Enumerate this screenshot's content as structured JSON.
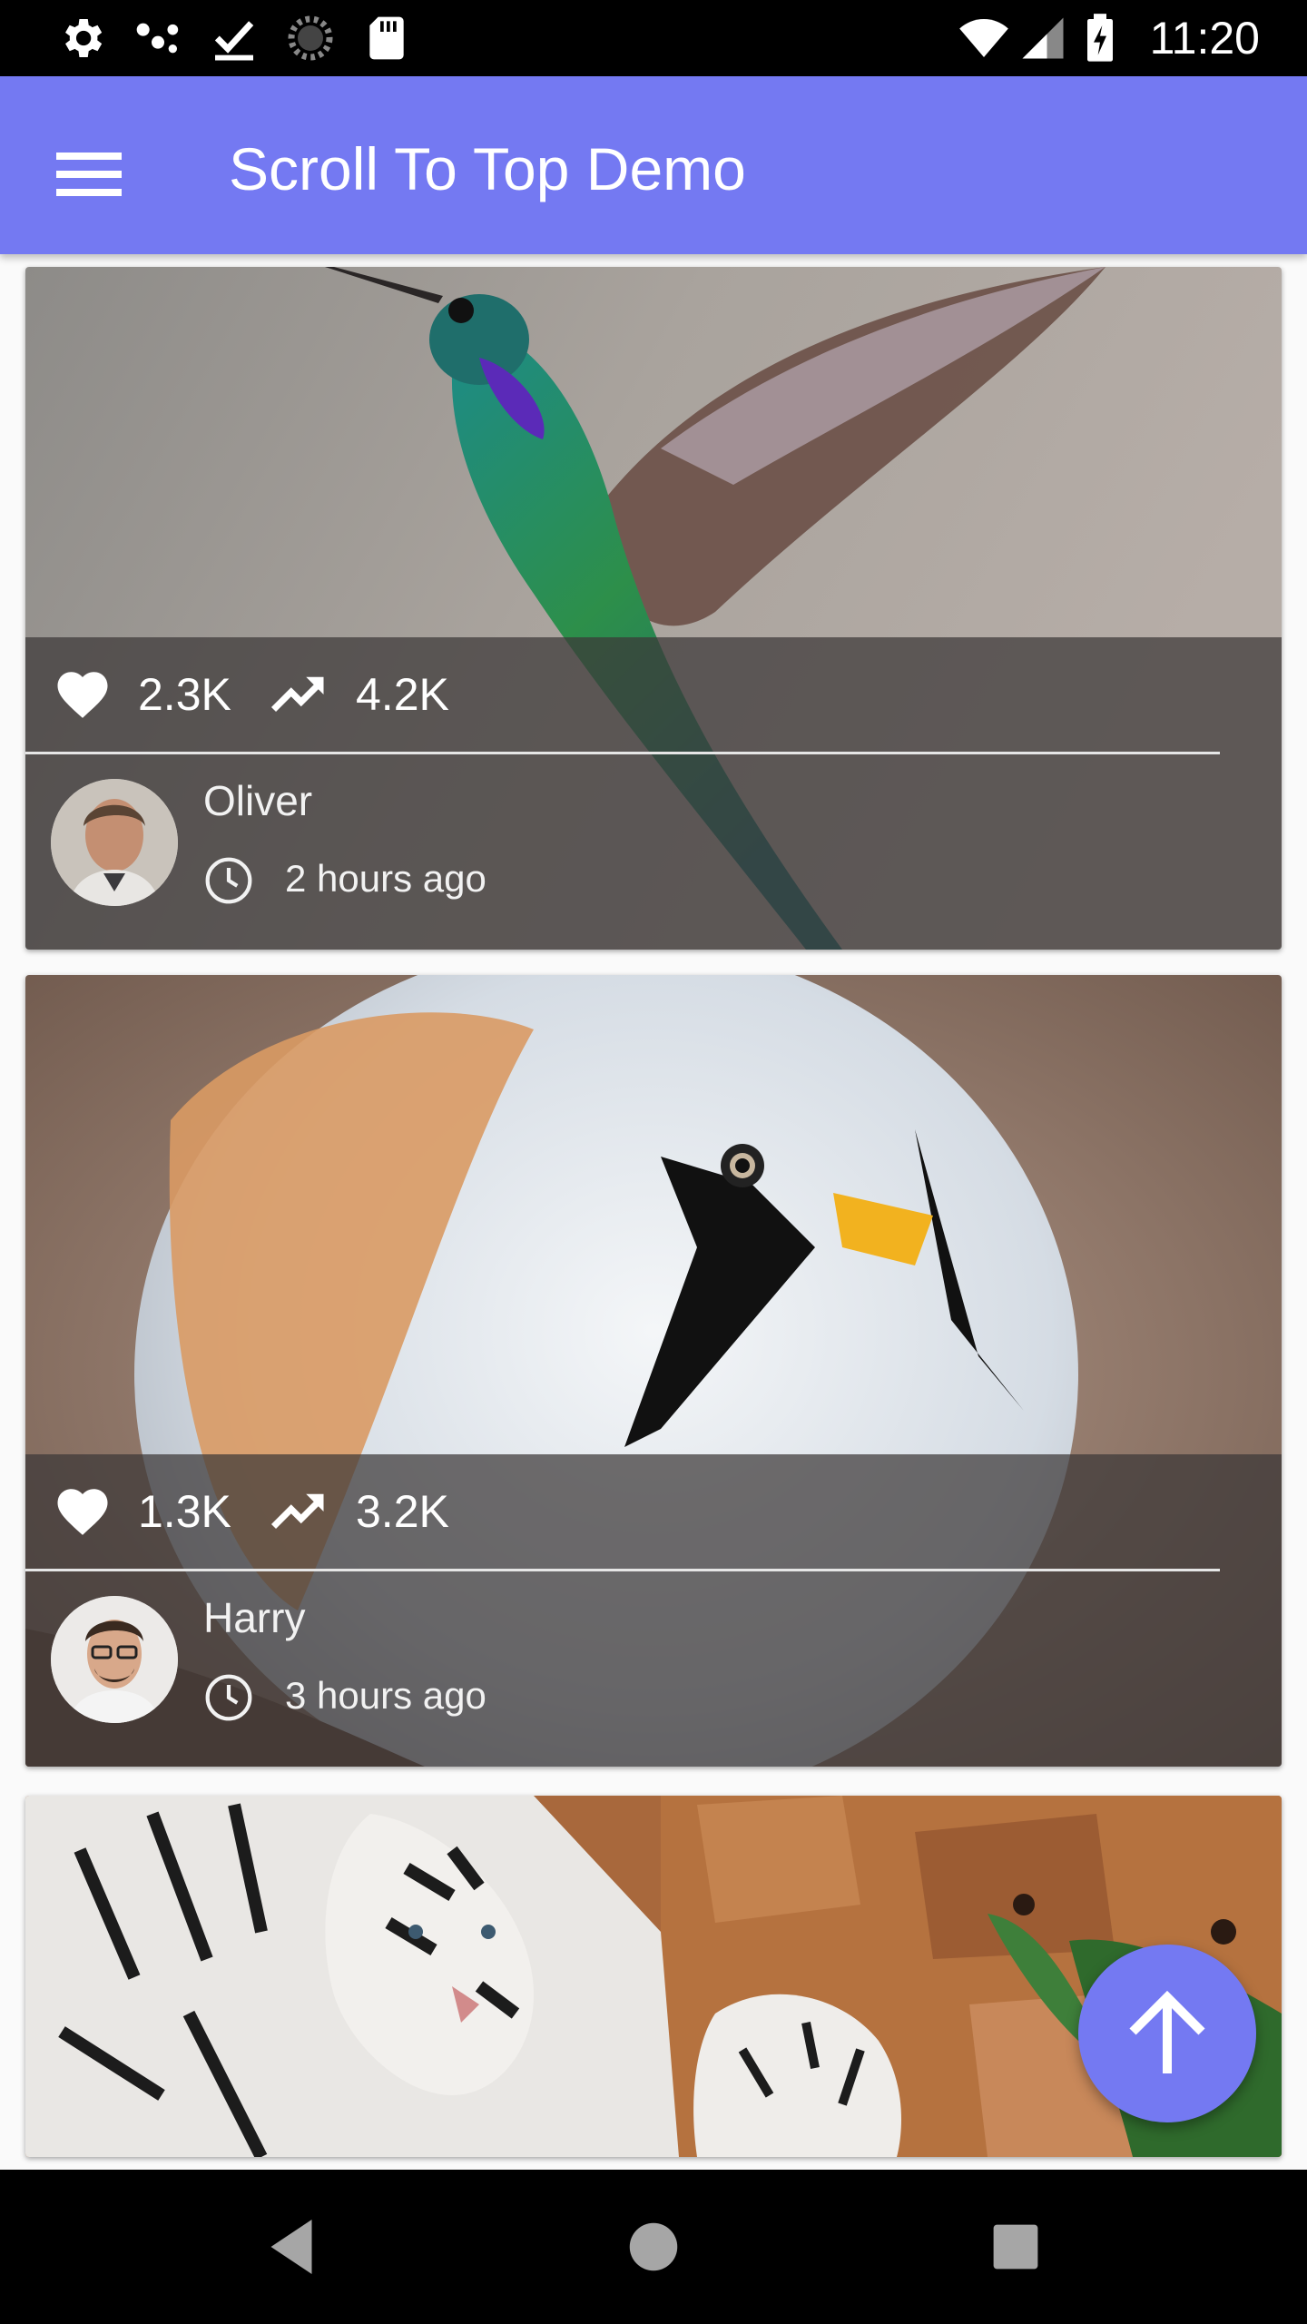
{
  "status_bar": {
    "time": "11:20",
    "left_icons": [
      "settings-icon",
      "usb-icon",
      "download-done-icon",
      "loading-icon",
      "sd-card-icon"
    ],
    "right_icons": [
      "wifi-icon",
      "signal-icon",
      "battery-charging-icon"
    ]
  },
  "app_bar": {
    "title": "Scroll To Top Demo",
    "menu_icon": "menu-icon",
    "color": "#7479f2"
  },
  "cards": [
    {
      "image": "hummingbird",
      "likes": "2.3K",
      "trending": "4.2K",
      "author": "Oliver",
      "time": "2 hours ago"
    },
    {
      "image": "bearded-reedling-bird",
      "likes": "1.3K",
      "trending": "3.2K",
      "author": "Harry",
      "time": "3 hours ago"
    },
    {
      "image": "white-tigers"
    }
  ],
  "fab": {
    "icon": "arrow-up-icon",
    "color": "#7479f2"
  },
  "nav_bar": {
    "buttons": [
      "back-icon",
      "home-icon",
      "recents-icon"
    ]
  }
}
